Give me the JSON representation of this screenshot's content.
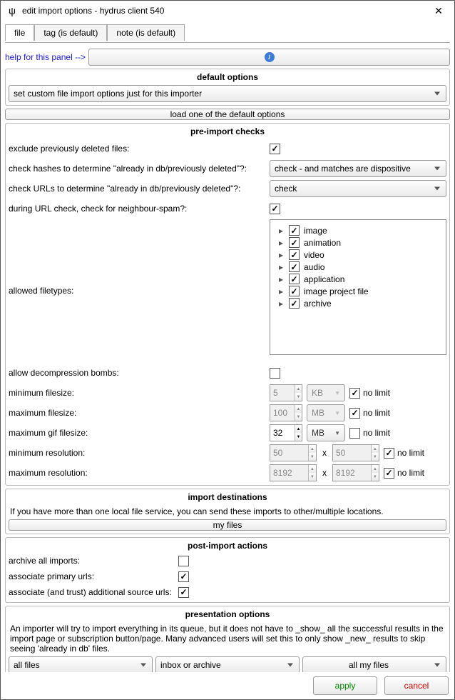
{
  "window": {
    "title": "edit import options - hydrus client 540"
  },
  "tabs": {
    "file": "file",
    "tag": "tag (is default)",
    "note": "note (is default)"
  },
  "help": {
    "label": "help for this panel -->"
  },
  "defaults": {
    "title": "default options",
    "select": "set custom file import options just for this importer",
    "load_button": "load one of the default options"
  },
  "pre": {
    "title": "pre-import checks",
    "exclude_label": "exclude previously deleted files:",
    "hash_label": "check hashes to determine \"already in db/previously deleted\"?:",
    "hash_select": "check - and matches are dispositive",
    "url_label": "check URLs to determine \"already in db/previously deleted\"?:",
    "url_select": "check",
    "neighbour_label": "during URL check, check for neighbour-spam?:",
    "filetypes_label": "allowed filetypes:",
    "filetypes": [
      "image",
      "animation",
      "video",
      "audio",
      "application",
      "image project file",
      "archive"
    ],
    "decomp_label": "allow decompression bombs:",
    "minfs_label": "minimum filesize:",
    "minfs_value": "5",
    "minfs_unit": "KB",
    "maxfs_label": "maximum filesize:",
    "maxfs_value": "100",
    "maxfs_unit": "MB",
    "maxgif_label": "maximum gif filesize:",
    "maxgif_value": "32",
    "maxgif_unit": "MB",
    "minres_label": "minimum resolution:",
    "minres_w": "50",
    "minres_h": "50",
    "maxres_label": "maximum resolution:",
    "maxres_w": "8192",
    "maxres_h": "8192",
    "nolimit": "no limit"
  },
  "dest": {
    "title": "import destinations",
    "text": "If you have more than one local file service, you can send these imports to other/multiple locations.",
    "button": "my files"
  },
  "post": {
    "title": "post-import actions",
    "archive": "archive all imports:",
    "primary": "associate primary urls:",
    "additional": "associate (and trust) additional source urls:"
  },
  "pres": {
    "title": "presentation options",
    "text": "An importer will try to import everything in its queue, but it does not have to _show_ all the successful results in the import page or subscription button/page. Many advanced users will set this to only show _new_ results to skip seeing 'already in db' files.",
    "sel1": "all files",
    "sel2": "inbox or archive",
    "sel3": "all my files"
  },
  "footer": {
    "apply": "apply",
    "cancel": "cancel"
  }
}
